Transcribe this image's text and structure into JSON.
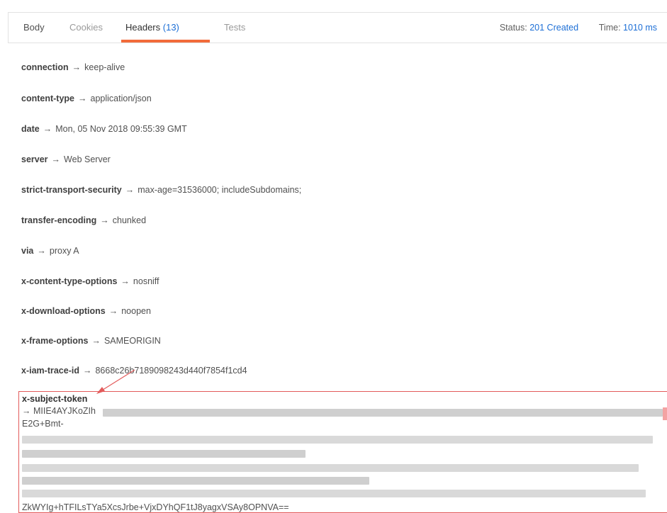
{
  "tabs": {
    "body": "Body",
    "cookies": "Cookies",
    "headers": "Headers",
    "headers_count": "(13)",
    "tests": "Tests"
  },
  "status": {
    "status_label": "Status:",
    "status_value": "201 Created",
    "time_label": "Time:",
    "time_value": "1010 ms"
  },
  "arrow": "→",
  "headers": [
    {
      "key": "connection",
      "value": "keep-alive"
    },
    {
      "key": "content-type",
      "value": "application/json"
    },
    {
      "key": "date",
      "value": "Mon, 05 Nov 2018 09:55:39 GMT"
    },
    {
      "key": "server",
      "value": "Web Server"
    },
    {
      "key": "strict-transport-security",
      "value": "max-age=31536000; includeSubdomains;"
    },
    {
      "key": "transfer-encoding",
      "value": "chunked"
    },
    {
      "key": "via",
      "value": "proxy A"
    },
    {
      "key": "x-content-type-options",
      "value": "nosniff"
    },
    {
      "key": "x-download-options",
      "value": "noopen"
    },
    {
      "key": "x-frame-options",
      "value": "SAMEORIGIN"
    },
    {
      "key": "x-iam-trace-id",
      "value": "8668c26b7189098243d440f7854f1cd4"
    }
  ],
  "token": {
    "key": "x-subject-token",
    "line1": "→  MIIE4AYJKoZIh",
    "line2": "E2G+Bmt-",
    "last_line": "ZkWYIg+hTFILsTYa5XcsJrbe+VjxDYhQF1tJ8yagxVSAy8OPNVA=="
  },
  "colors": {
    "accent_blue": "#1d6fd6",
    "tab_underline": "#f26b3a",
    "annotation_red": "#e35b5b"
  }
}
